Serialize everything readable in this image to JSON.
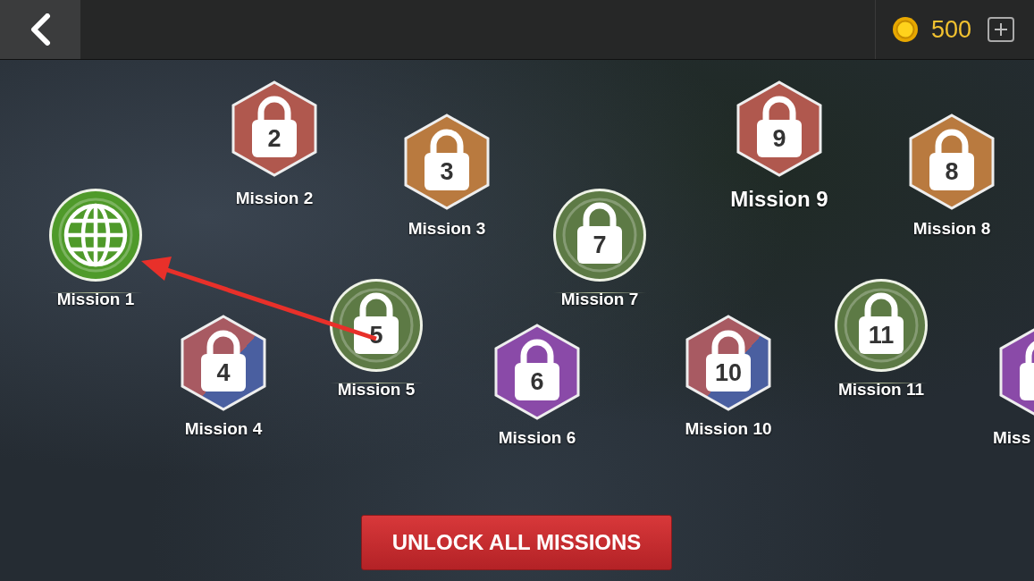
{
  "top_bar": {
    "coins": "500"
  },
  "missions": [
    {
      "label": "Mission 2",
      "number": "2",
      "kind": "hex",
      "color": "#b0584e",
      "locked": true
    },
    {
      "label": "Mission 9",
      "number": "9",
      "kind": "hex",
      "color": "#b0584e",
      "locked": true
    },
    {
      "label": "Mission 3",
      "number": "3",
      "kind": "hex",
      "color": "#b97a3f",
      "locked": true
    },
    {
      "label": "Mission 8",
      "number": "8",
      "kind": "hex",
      "color": "#b97a3f",
      "locked": true
    },
    {
      "label": "Mission 1",
      "kind": "circle",
      "color": "#4f9a2a",
      "locked": false
    },
    {
      "label": "Mission 7",
      "number": "7",
      "kind": "circle",
      "color": "#5d7a45",
      "locked": true
    },
    {
      "label": "Mission 5",
      "number": "5",
      "kind": "circle",
      "color": "#5d7a45",
      "locked": true
    },
    {
      "label": "Mission 11",
      "number": "11",
      "kind": "circle",
      "color": "#5d7a45",
      "locked": true
    },
    {
      "label": "Mission 4",
      "number": "4",
      "kind": "hex-split",
      "color": "#a85a62",
      "locked": true
    },
    {
      "label": "Mission 10",
      "number": "10",
      "kind": "hex-split",
      "color": "#a85a62",
      "locked": true
    },
    {
      "label": "Mission 6",
      "number": "6",
      "kind": "hex",
      "color": "#8a4aa8",
      "locked": true
    },
    {
      "label": "Miss",
      "kind": "hex",
      "color": "#8a4aa8",
      "locked": true
    }
  ],
  "unlock_button": "UNLOCK ALL MISSIONS"
}
